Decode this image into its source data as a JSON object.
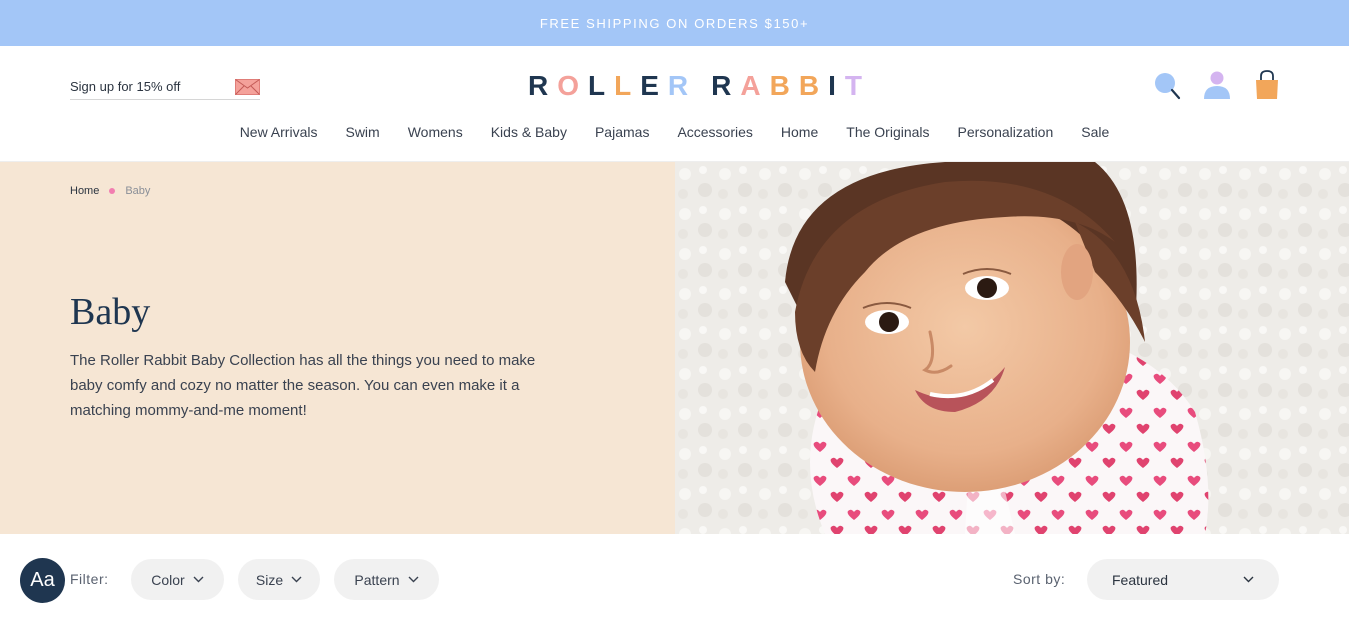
{
  "promo": {
    "text": "FREE SHIPPING ON ORDERS $150+"
  },
  "header": {
    "signup_label": "Sign up for 15% off",
    "signup_icon": "mail-icon",
    "logo": {
      "words": [
        {
          "letters": [
            {
              "char": "R",
              "color": "#1f3650"
            },
            {
              "char": "O",
              "color": "#f4a19a"
            },
            {
              "char": "L",
              "color": "#1f3650"
            },
            {
              "char": "L",
              "color": "#f2a65a"
            },
            {
              "char": "E",
              "color": "#1f3650"
            },
            {
              "char": "R",
              "color": "#a3c6f7"
            }
          ]
        },
        {
          "letters": [
            {
              "char": "R",
              "color": "#1f3650"
            },
            {
              "char": "A",
              "color": "#f4a19a"
            },
            {
              "char": "B",
              "color": "#f2a65a"
            },
            {
              "char": "B",
              "color": "#f2a65a"
            },
            {
              "char": "I",
              "color": "#1f3650"
            },
            {
              "char": "T",
              "color": "#d4b4f0"
            }
          ]
        }
      ]
    },
    "icons": [
      "search-icon",
      "account-icon",
      "cart-icon"
    ],
    "nav": [
      "New Arrivals",
      "Swim",
      "Womens",
      "Kids & Baby",
      "Pajamas",
      "Accessories",
      "Home",
      "The Originals",
      "Personalization",
      "Sale"
    ]
  },
  "breadcrumb": {
    "home": "Home",
    "current": "Baby"
  },
  "hero": {
    "title": "Baby",
    "description": "The Roller Rabbit Baby Collection has all the things you need to make baby comfy and cozy no matter the season. You can even make it a matching mommy-and-me moment!",
    "image": "baby-photo"
  },
  "filters": {
    "label": "Filter:",
    "options": [
      "Color",
      "Size",
      "Pattern"
    ],
    "sort_label": "Sort by:",
    "sort_value": "Featured",
    "a11y_label": "Aa"
  },
  "colors": {
    "promo_bg": "#a3c6f7",
    "hero_bg": "#f6e6d4",
    "navy": "#1f3650",
    "accent_pink": "#f27eb0"
  }
}
